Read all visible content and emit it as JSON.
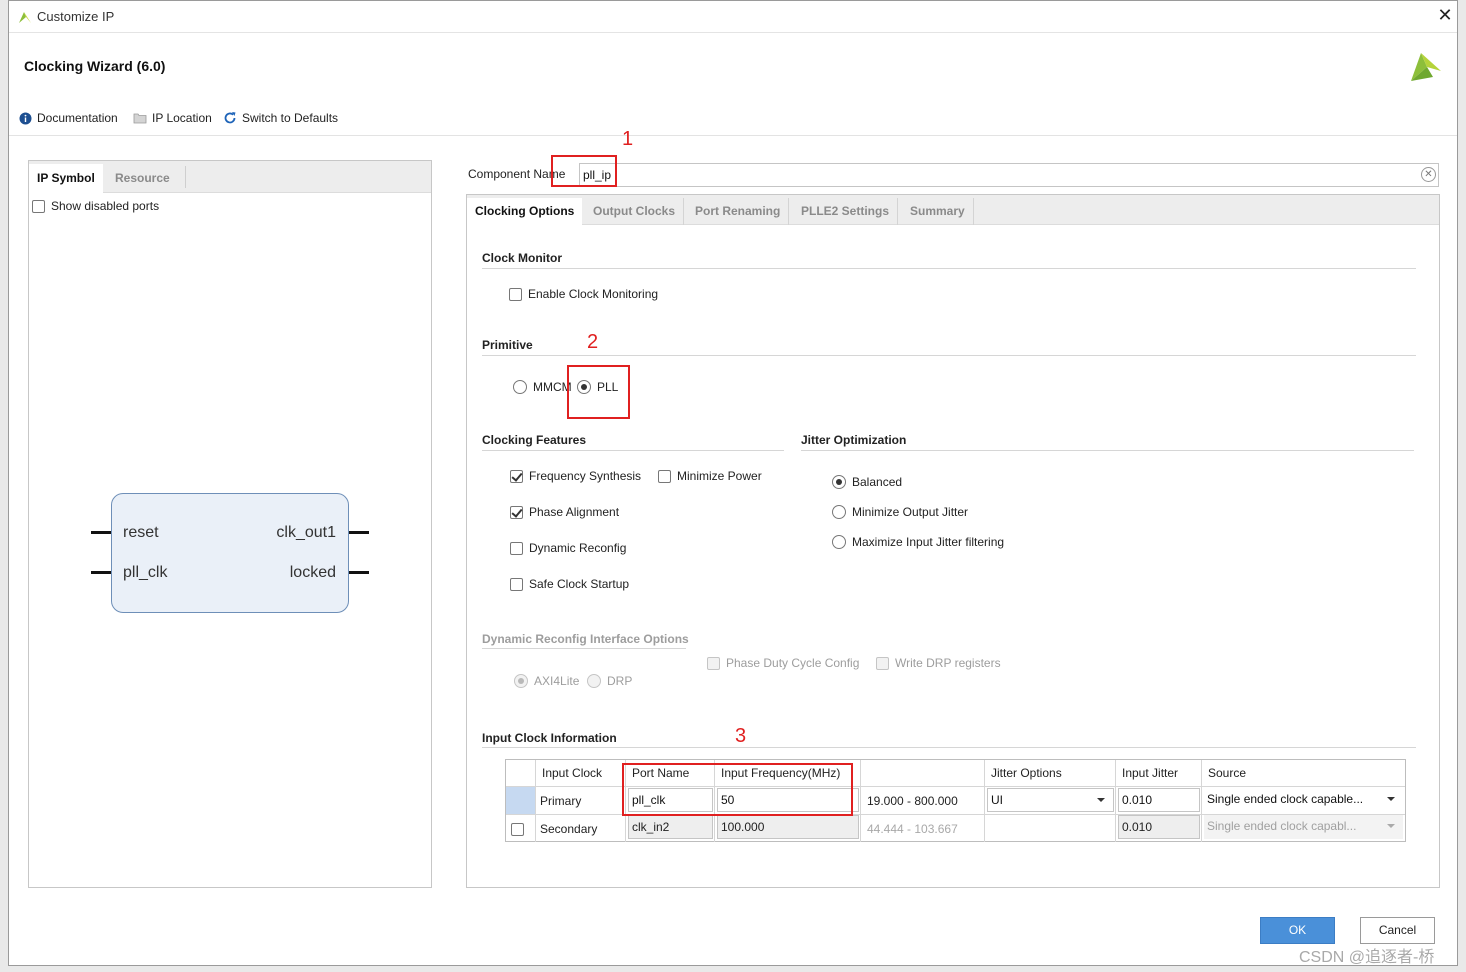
{
  "window": {
    "title": "Customize IP",
    "header_title": "Clocking Wizard (6.0)"
  },
  "toolbar": {
    "documentation": "Documentation",
    "ip_location": "IP Location",
    "switch_defaults": "Switch to Defaults"
  },
  "left_pane": {
    "tabs": [
      "IP Symbol",
      "Resource"
    ],
    "show_disabled_ports": "Show disabled ports",
    "symbol": {
      "left_ports": [
        "reset",
        "pll_clk"
      ],
      "right_ports": [
        "clk_out1",
        "locked"
      ]
    }
  },
  "component": {
    "label": "Component Name",
    "value": "pll_ip"
  },
  "right_tabs": [
    "Clocking Options",
    "Output Clocks",
    "Port Renaming",
    "PLLE2 Settings",
    "Summary"
  ],
  "clock_monitor": {
    "title": "Clock Monitor",
    "enable": "Enable Clock Monitoring"
  },
  "primitive": {
    "title": "Primitive",
    "mmcm": "MMCM",
    "pll": "PLL",
    "selected": "PLL"
  },
  "clocking_features": {
    "title": "Clocking Features",
    "frequency_synthesis": "Frequency Synthesis",
    "minimize_power": "Minimize Power",
    "phase_alignment": "Phase Alignment",
    "dynamic_reconfig": "Dynamic Reconfig",
    "safe_clock_startup": "Safe Clock Startup"
  },
  "jitter_optimization": {
    "title": "Jitter Optimization",
    "balanced": "Balanced",
    "minimize_output": "Minimize Output Jitter",
    "maximize_input": "Maximize Input Jitter filtering"
  },
  "dynamic_reconfig_options": {
    "title": "Dynamic Reconfig Interface Options",
    "phase_duty": "Phase Duty Cycle Config",
    "write_drp": "Write DRP registers",
    "axi4lite": "AXI4Lite",
    "drp": "DRP"
  },
  "input_clock_info": {
    "title": "Input Clock Information",
    "headers": [
      "Input Clock",
      "Port Name",
      "Input Frequency(MHz)",
      "",
      "Jitter Options",
      "Input Jitter",
      "Source"
    ],
    "rows": [
      {
        "input_clock": "Primary",
        "port_name": "pll_clk",
        "freq": "50",
        "range": "19.000 - 800.000",
        "jitter_opt": "UI",
        "input_jitter": "0.010",
        "source": "Single ended clock capable..."
      },
      {
        "input_clock": "Secondary",
        "port_name": "clk_in2",
        "freq": "100.000",
        "range": "44.444 - 103.667",
        "jitter_opt": "",
        "input_jitter": "0.010",
        "source": "Single ended clock capabl..."
      }
    ]
  },
  "annotations": [
    "1",
    "2",
    "3"
  ],
  "buttons": {
    "ok": "OK",
    "cancel": "Cancel"
  },
  "watermark": "CSDN @追逐者-桥",
  "colors": {
    "ok_button": "#4a90d9",
    "annotation_red": "#e02020",
    "ip_block_fill": "#eaf0f8"
  }
}
